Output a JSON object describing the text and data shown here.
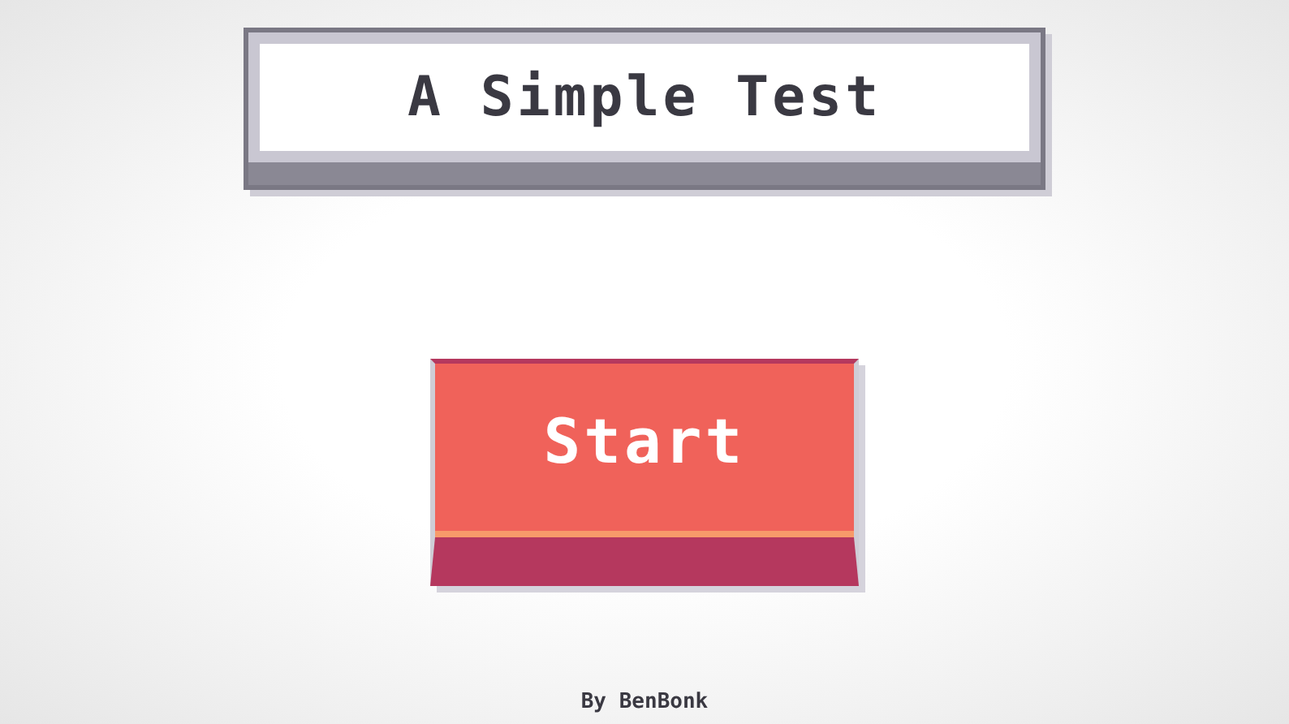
{
  "title": "A Simple Test",
  "start_button": {
    "label": "Start"
  },
  "credit": "By BenBonk"
}
